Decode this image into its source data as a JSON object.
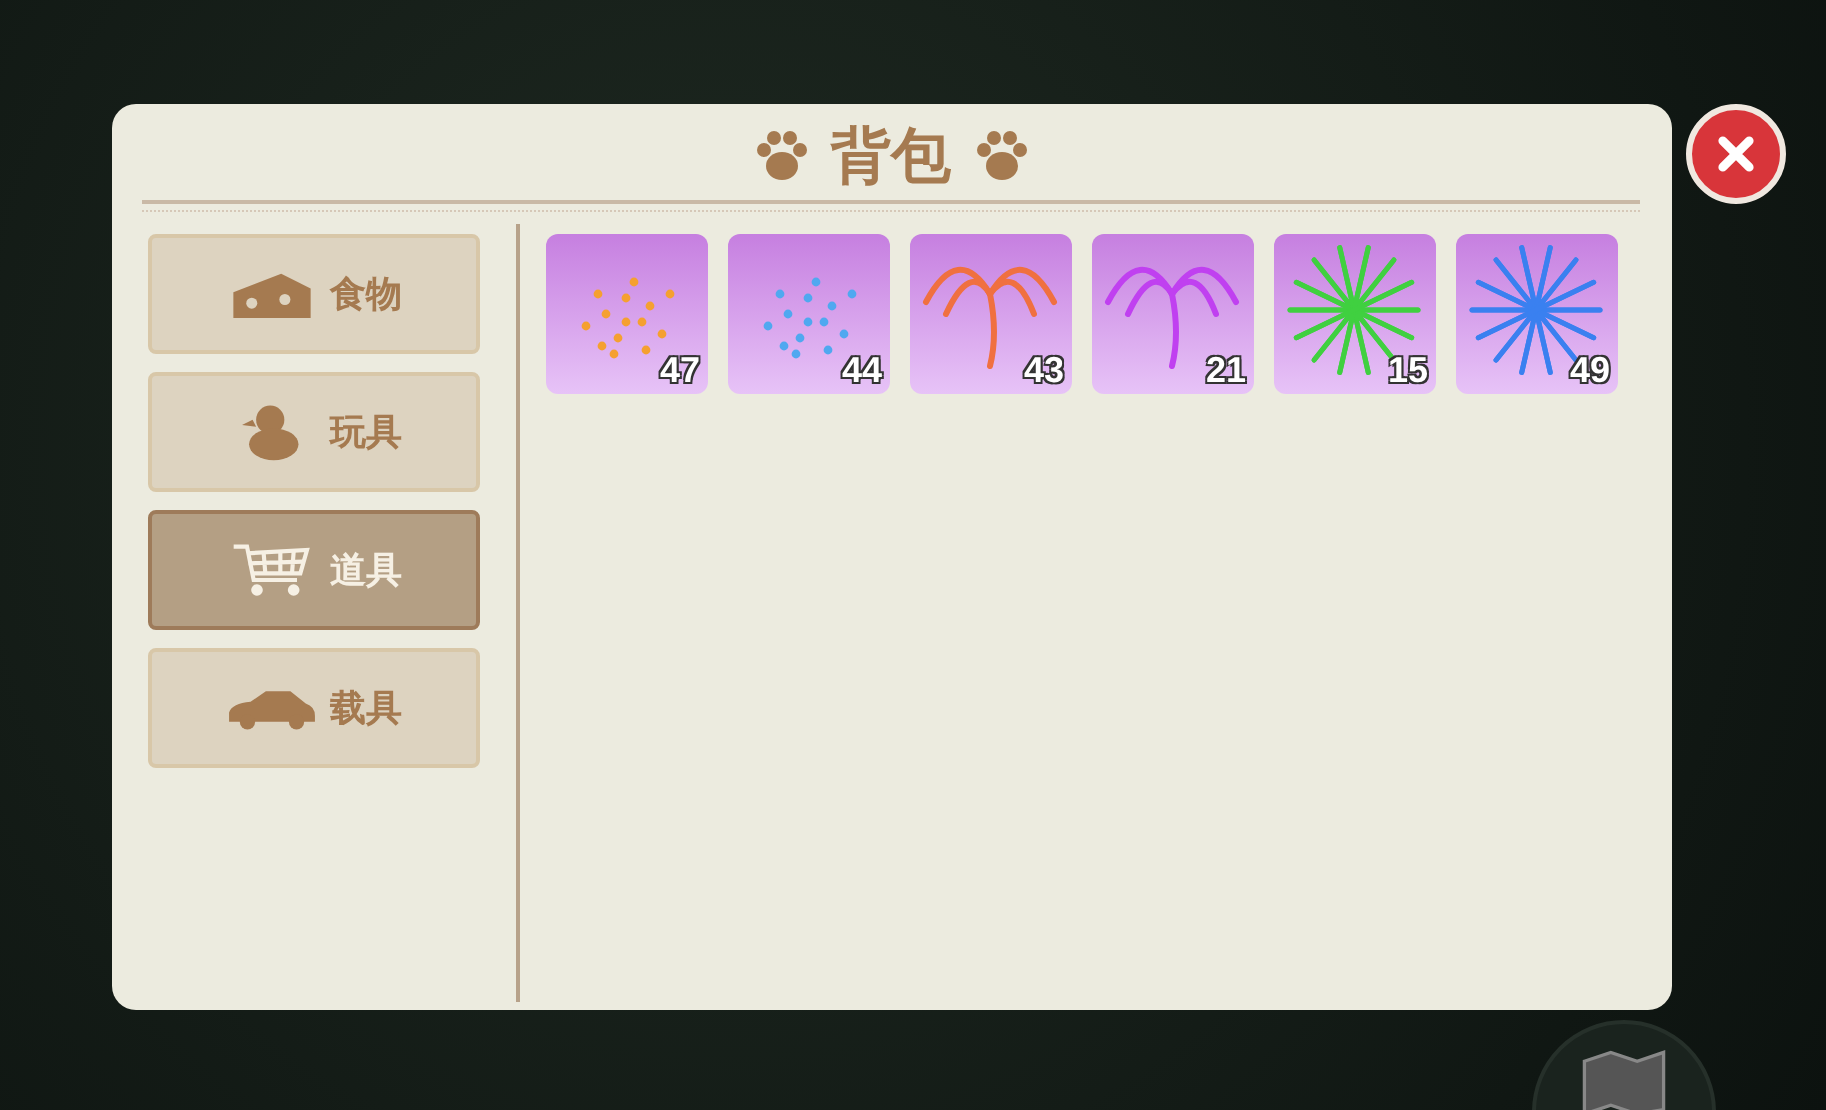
{
  "panel": {
    "title": "背包"
  },
  "categories": [
    {
      "label": "食物",
      "kind": "cheese",
      "selected": false
    },
    {
      "label": "玩具",
      "kind": "duck",
      "selected": false
    },
    {
      "label": "道具",
      "kind": "cart",
      "selected": true
    },
    {
      "label": "载具",
      "kind": "car",
      "selected": false
    }
  ],
  "items": [
    {
      "count": "47",
      "kind": "sparkle",
      "color": "#f5a030"
    },
    {
      "count": "44",
      "kind": "sparkle",
      "color": "#50a8f0"
    },
    {
      "count": "43",
      "kind": "arc",
      "color": "#f07040"
    },
    {
      "count": "21",
      "kind": "arc",
      "color": "#c040f0"
    },
    {
      "count": "15",
      "kind": "burst",
      "color": "#40d040"
    },
    {
      "count": "49",
      "kind": "burst",
      "color": "#3a80f0"
    }
  ]
}
